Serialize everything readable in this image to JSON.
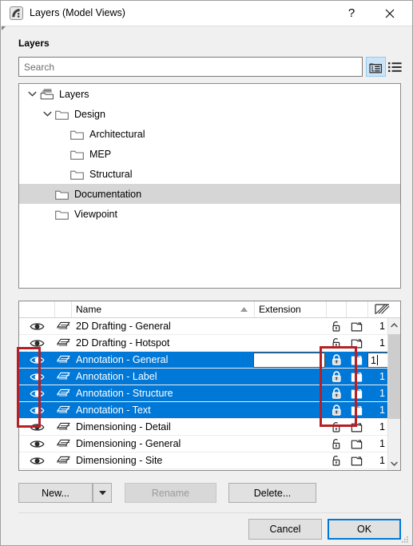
{
  "window": {
    "title": "Layers (Model Views)",
    "app_icon": "archicad-logo-icon",
    "help_label": "?",
    "close_label": "Close"
  },
  "section": {
    "label": "Layers"
  },
  "search": {
    "placeholder": "Search",
    "value": "",
    "tree_view_label": "Tree view",
    "list_view_label": "List view",
    "tree_view_active": true
  },
  "tree": {
    "nodes": [
      {
        "label": "Layers",
        "depth": 0,
        "expanded": true,
        "icon": "layers-stack-icon",
        "selected": false
      },
      {
        "label": "Design",
        "depth": 1,
        "expanded": true,
        "icon": "folder-icon",
        "selected": false
      },
      {
        "label": "Architectural",
        "depth": 2,
        "expanded": null,
        "icon": "folder-icon",
        "selected": false
      },
      {
        "label": "MEP",
        "depth": 2,
        "expanded": null,
        "icon": "folder-icon",
        "selected": false
      },
      {
        "label": "Structural",
        "depth": 2,
        "expanded": null,
        "icon": "folder-icon",
        "selected": false
      },
      {
        "label": "Documentation",
        "depth": 1,
        "expanded": null,
        "icon": "folder-icon",
        "selected": true
      },
      {
        "label": "Viewpoint",
        "depth": 1,
        "expanded": null,
        "icon": "folder-icon",
        "selected": false
      }
    ]
  },
  "table": {
    "columns": {
      "visibility": "",
      "solid": "",
      "name": "Name",
      "extension": "Extension",
      "lock": "",
      "copy": "",
      "pen": "pen-hatch-icon"
    },
    "sort_column": "Name",
    "sort_direction": "ascending",
    "rows": [
      {
        "name": "2D Drafting - General",
        "extension": "",
        "pen": "1",
        "selected": false,
        "locked": false
      },
      {
        "name": "2D Drafting - Hotspot",
        "extension": "",
        "pen": "1",
        "selected": false,
        "locked": false
      },
      {
        "name": "Annotation - General",
        "extension": "",
        "pen": "1",
        "selected": true,
        "locked": true,
        "editing": true
      },
      {
        "name": "Annotation - Label",
        "extension": "",
        "pen": "1",
        "selected": true,
        "locked": true
      },
      {
        "name": "Annotation - Structure",
        "extension": "",
        "pen": "1",
        "selected": true,
        "locked": true
      },
      {
        "name": "Annotation - Text",
        "extension": "",
        "pen": "1",
        "selected": true,
        "locked": true
      },
      {
        "name": "Dimensioning - Detail",
        "extension": "",
        "pen": "1",
        "selected": false,
        "locked": false
      },
      {
        "name": "Dimensioning - General",
        "extension": "",
        "pen": "1",
        "selected": false,
        "locked": false
      },
      {
        "name": "Dimensioning - Site",
        "extension": "",
        "pen": "1",
        "selected": false,
        "locked": false
      }
    ],
    "inline_edit": {
      "extension_value": "",
      "pen_value": "1"
    }
  },
  "buttons": {
    "new": "New...",
    "new_dropdown": "▼",
    "rename": "Rename",
    "rename_enabled": false,
    "delete": "Delete...",
    "cancel": "Cancel",
    "ok": "OK"
  },
  "annotations": {
    "highlight_color": "#b52026",
    "boxes": [
      {
        "name": "visibility-column-highlight"
      },
      {
        "name": "lock-copy-column-highlight"
      }
    ]
  },
  "colors": {
    "selection_blue": "#0078d7",
    "tree_selection_gray": "#d6d6d6",
    "dialog_background": "#f0f0f0",
    "accent": "#0078d7"
  }
}
